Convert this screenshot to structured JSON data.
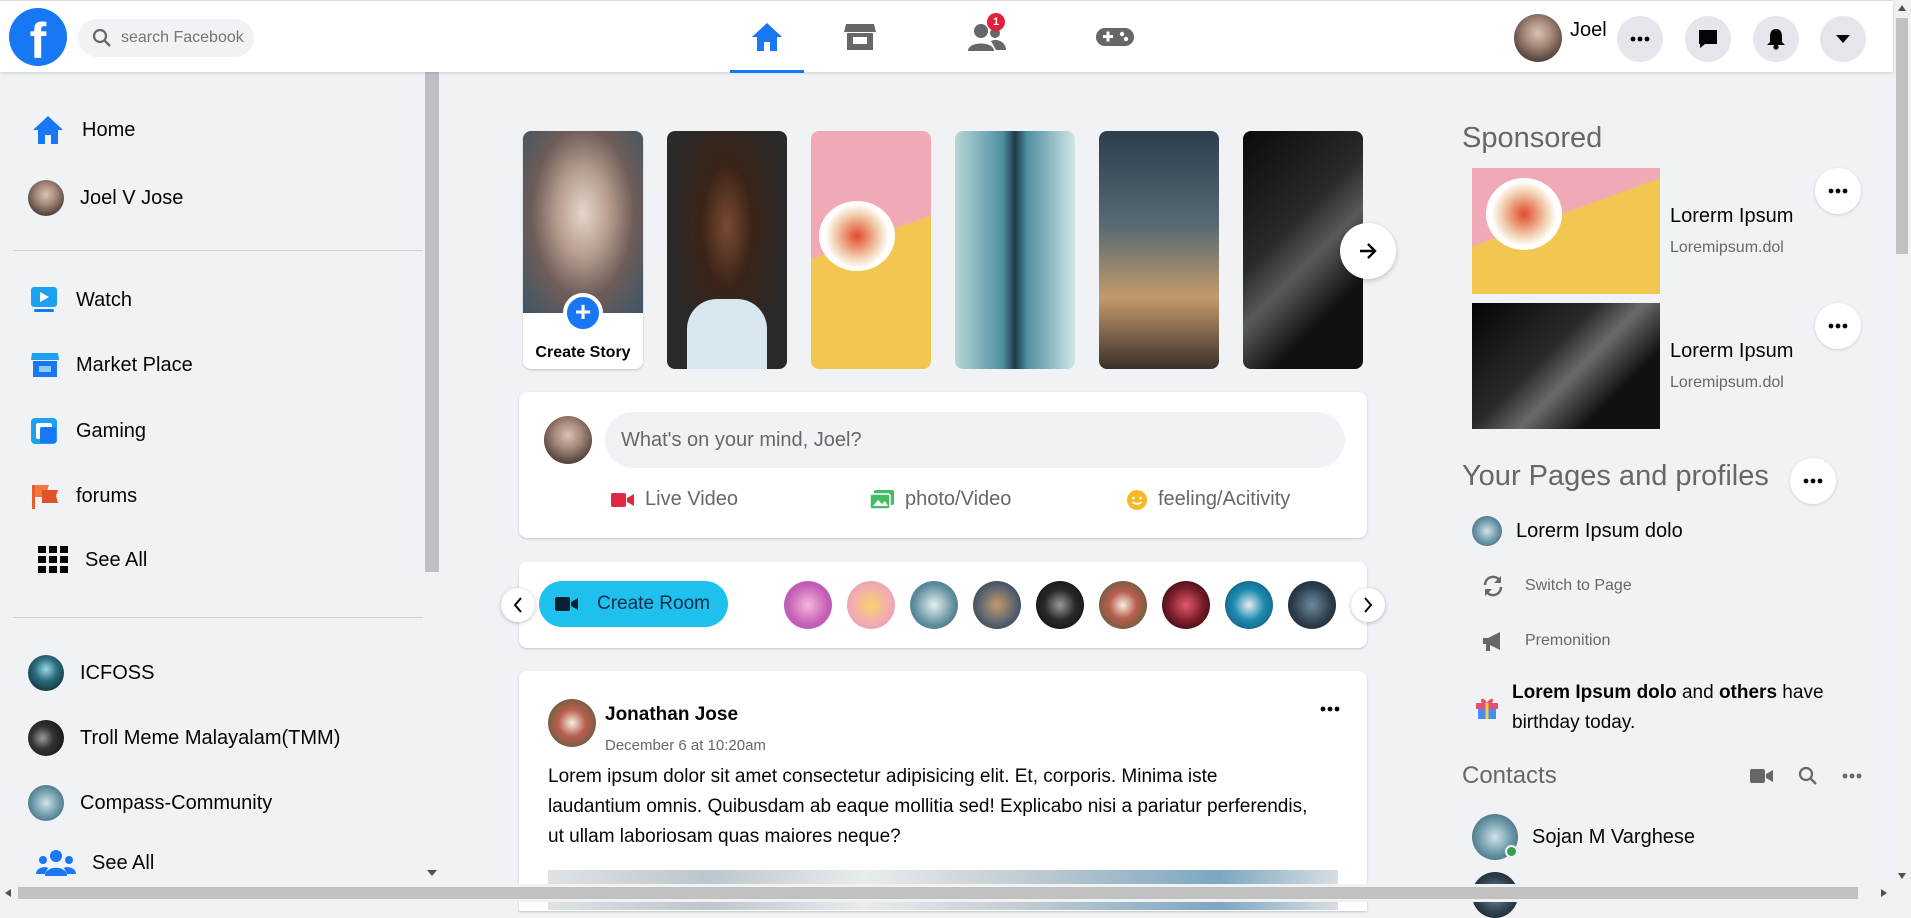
{
  "brand": {
    "logo_letter": "f",
    "color": "#1877f2"
  },
  "search": {
    "placeholder": "search Facebook"
  },
  "nav": {
    "friends_badge": "1"
  },
  "user": {
    "first_name": "Joel"
  },
  "sidebar": {
    "items": [
      {
        "label": "Home",
        "icon": "home-icon"
      },
      {
        "label": "Joel V Jose",
        "icon": "avatar"
      },
      {
        "label": "Watch",
        "icon": "watch-icon"
      },
      {
        "label": "Market Place",
        "icon": "marketplace-icon"
      },
      {
        "label": "Gaming",
        "icon": "gaming-icon"
      },
      {
        "label": "forums",
        "icon": "forums-icon"
      },
      {
        "label": "See All",
        "icon": "grid-icon"
      }
    ],
    "groups": [
      {
        "label": "ICFOSS"
      },
      {
        "label": "Troll Meme Malayalam(TMM)"
      },
      {
        "label": "Compass-Community"
      },
      {
        "label": "See All"
      }
    ]
  },
  "stories": {
    "create_label": "Create Story",
    "plus": "+"
  },
  "composer": {
    "placeholder": "What's on your mind, Joel?",
    "live": "Live Video",
    "photo": "photo/Video",
    "feeling": "feeling/Acitivity"
  },
  "rooms": {
    "create_label": "Create Room"
  },
  "post": {
    "author": "Jonathan Jose",
    "date": "December 6 at 10:20am",
    "text": "Lorem ipsum dolor sit amet consectetur adipisicing elit. Et, corporis. Minima iste laudantium omnis. Quibusdam ab eaque mollitia sed! Explicabo nisi a pariatur perferendis, ut ullam laboriosam quas maiores neque?"
  },
  "sponsored": {
    "title": "Sponsored",
    "ads": [
      {
        "title": "Lorerm Ipsum",
        "url": "Loremipsum.dol"
      },
      {
        "title": "Lorerm Ipsum",
        "url": "Loremipsum.dol"
      }
    ]
  },
  "pages": {
    "title": "Your Pages and profiles",
    "page_name": "Lorerm Ipsum dolo",
    "switch": "Switch to Page",
    "promotion": "Premonition"
  },
  "birthday": {
    "name": "Lorem Ipsum dolo",
    "and": " and ",
    "others": "others",
    "suffix": " have birthday today."
  },
  "contacts": {
    "title": "Contacts",
    "items": [
      {
        "name": "Sojan M Varghese"
      }
    ]
  }
}
